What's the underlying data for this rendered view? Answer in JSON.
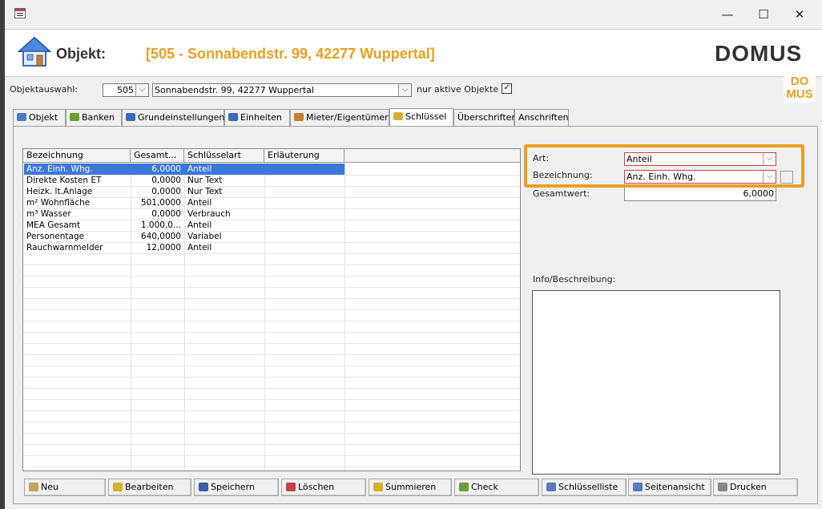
{
  "window": {
    "controls": {
      "minimize": "—",
      "maximize": "☐",
      "close": "✕"
    }
  },
  "header": {
    "label": "Objekt:",
    "title": "[505 - Sonnabendstr. 99, 42277 Wuppertal]",
    "logo_text": "DOMUS",
    "small_logo": [
      "DO",
      "MUS"
    ]
  },
  "selector": {
    "label": "Objektauswahl:",
    "number": "505",
    "address": "Sonnabendstr. 99, 42277 Wuppertal",
    "active_label": "nur aktive Objekte",
    "active_checked": "✓"
  },
  "tabs": [
    {
      "label": "Objekt",
      "icon": "house-icon",
      "color": "#4a7ac8"
    },
    {
      "label": "Banken",
      "icon": "money-icon",
      "color": "#6aa030"
    },
    {
      "label": "Grundeinstellungen",
      "icon": "tree-icon",
      "color": "#3a6ab8"
    },
    {
      "label": "Einheiten",
      "icon": "building-icon",
      "color": "#3a6ab8"
    },
    {
      "label": "Mieter/Eigentümer",
      "icon": "people-icon",
      "color": "#c08030"
    },
    {
      "label": "Schlüssel",
      "icon": "key-icon",
      "color": "#d8b030"
    },
    {
      "label": "Überschriften",
      "icon": "",
      "color": ""
    },
    {
      "label": "Anschriften",
      "icon": "",
      "color": ""
    }
  ],
  "active_tab": "Schlüssel",
  "table": {
    "columns": [
      "Bezeichnung",
      "Gesamt...",
      "Schlüsselart",
      "Erläuterung"
    ],
    "rows": [
      {
        "bezeichnung": "Anz. Einh. Whg.",
        "gesamt": "6,0000",
        "art": "Anteil",
        "erl": ""
      },
      {
        "bezeichnung": "Direkte Kosten ET",
        "gesamt": "0,0000",
        "art": "Nur Text",
        "erl": ""
      },
      {
        "bezeichnung": "Heizk. lt.Anlage",
        "gesamt": "0,0000",
        "art": "Nur Text",
        "erl": ""
      },
      {
        "bezeichnung": "m² Wohnfläche",
        "gesamt": "501,0000",
        "art": "Anteil",
        "erl": ""
      },
      {
        "bezeichnung": "m³ Wasser",
        "gesamt": "0,0000",
        "art": "Verbrauch",
        "erl": ""
      },
      {
        "bezeichnung": "MEA Gesamt",
        "gesamt": "1.000,0...",
        "art": "Anteil",
        "erl": ""
      },
      {
        "bezeichnung": "Personentage",
        "gesamt": "640,0000",
        "art": "Variabel",
        "erl": ""
      },
      {
        "bezeichnung": "Rauchwarnmelder",
        "gesamt": "12,0000",
        "art": "Anteil",
        "erl": ""
      }
    ]
  },
  "detail": {
    "art_label": "Art:",
    "art_value": "Anteil",
    "bez_label": "Bezeichnung:",
    "bez_value": "Anz. Einh. Whg.",
    "gesamt_label": "Gesamtwert:",
    "gesamt_value": "6,0000",
    "info_label": "Info/Beschreibung:",
    "info_value": ""
  },
  "buttons": [
    {
      "label": "Neu",
      "icon": "new-icon",
      "color": "#c8a060"
    },
    {
      "label": "Bearbeiten",
      "icon": "edit-icon",
      "color": "#d8b030"
    },
    {
      "label": "Speichern",
      "icon": "save-icon",
      "color": "#3a5aa8"
    },
    {
      "label": "Löschen",
      "icon": "delete-icon",
      "color": "#c84040"
    },
    {
      "label": "Summieren",
      "icon": "sum-icon",
      "color": "#d8b030"
    },
    {
      "label": "Check",
      "icon": "check-icon",
      "color": "#6aa030"
    },
    {
      "label": "Schlüsselliste",
      "icon": "list-icon",
      "color": "#5a7ab8"
    },
    {
      "label": "Seitenansicht",
      "icon": "preview-icon",
      "color": "#5a7ab8"
    },
    {
      "label": "Drucken",
      "icon": "print-icon",
      "color": "#888888"
    }
  ],
  "colors": {
    "accent": "#e8a020",
    "selection": "#3c78d8",
    "error_border": "#d04040"
  }
}
